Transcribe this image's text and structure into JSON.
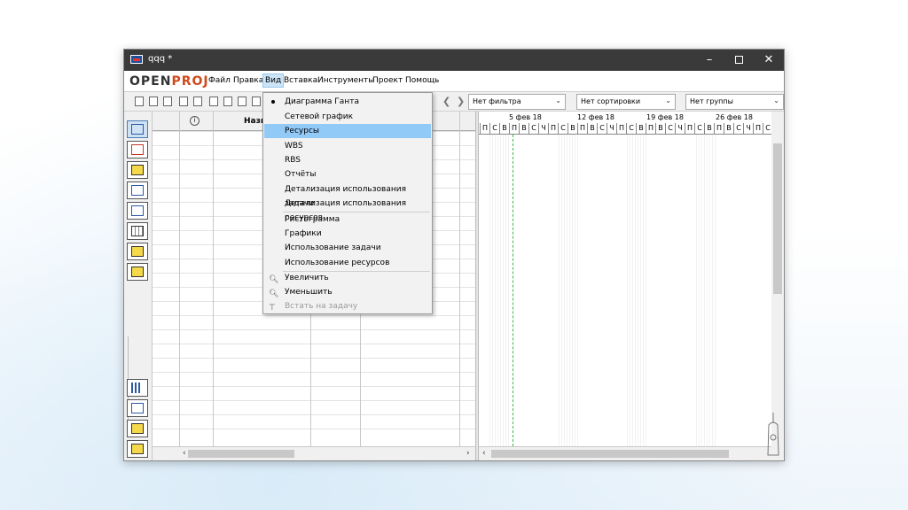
{
  "window": {
    "title": "qqq *"
  },
  "logo": {
    "open": "OPEN",
    "proj": "PROJ"
  },
  "menu": {
    "file": "Файл",
    "edit": "Правка",
    "view": "Вид",
    "insert": "Вставка",
    "tools": "Инструменты",
    "project": "Проект",
    "help": "Помощь"
  },
  "toolbar": {
    "filter": "Нет фильтра",
    "sort": "Нет сортировки",
    "group": "Нет группы"
  },
  "table": {
    "name_header": "Назв"
  },
  "gantt": {
    "weeks": [
      "5 фев 18",
      "12 фев 18",
      "19 фев 18",
      "26 фев 18"
    ],
    "days": [
      "П",
      "С",
      "В",
      "П",
      "В",
      "С",
      "Ч",
      "П",
      "С",
      "В",
      "П",
      "В",
      "С",
      "Ч",
      "П",
      "С",
      "В",
      "П",
      "В",
      "С",
      "Ч",
      "П",
      "С",
      "В",
      "П",
      "В",
      "С",
      "Ч",
      "П",
      "С"
    ]
  },
  "view_menu": {
    "items": [
      {
        "label": "Диаграмма Ганта",
        "selected": true
      },
      {
        "label": "Сетевой график"
      },
      {
        "label": "Ресурсы",
        "highlighted": true
      },
      {
        "label": "WBS"
      },
      {
        "label": "RBS"
      },
      {
        "label": "Отчёты"
      },
      {
        "label": "Детализация использования задачи"
      },
      {
        "label": "Детализация использования ресурсов"
      },
      {
        "label": "Гистограмма"
      },
      {
        "label": "Графики"
      },
      {
        "label": "Использование задачи"
      },
      {
        "label": "Использование ресурсов"
      },
      {
        "label": "Увеличить",
        "icon": "zoom-in-icon"
      },
      {
        "label": "Уменьшить",
        "icon": "zoom-out-icon"
      },
      {
        "label": "Встать на задачу",
        "icon": "scroll-to-task-icon",
        "disabled": true
      }
    ]
  }
}
